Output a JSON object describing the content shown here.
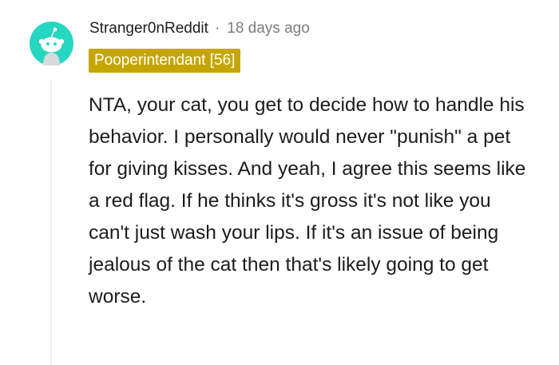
{
  "comment": {
    "author": "Stranger0nReddit",
    "separator": "·",
    "timestamp": "18 days ago",
    "flair": "Pooperintendant [56]",
    "body": "NTA, your cat, you get to decide how to handle his behavior. I personally would never \"punish\" a pet for giving kisses. And yeah, I agree this seems like a red flag. If he thinks it's gross it's not like you can't just wash your lips. If it's an issue of being jealous of the cat then that's likely going to get worse.",
    "avatar_icon": "reddit-snoo-avatar-icon"
  },
  "colors": {
    "avatar_background": "#25d6c0",
    "flair_background": "#c5a600",
    "flair_text": "#ffffff",
    "timestamp": "#7c7c7c",
    "body_text": "#1c1c1c",
    "thread_line": "#edeff1"
  }
}
